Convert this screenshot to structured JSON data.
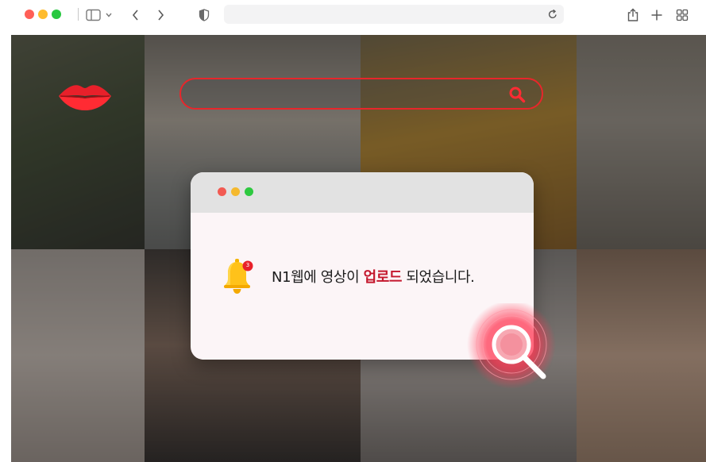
{
  "browser": {
    "url": "",
    "icons": {
      "sidebar": "sidebar-icon",
      "back": "chevron-left-icon",
      "forward": "chevron-right-icon",
      "privacy": "shield-icon",
      "reload": "reload-icon",
      "share": "share-icon",
      "new_tab": "plus-icon",
      "tabs": "tab-overview-icon"
    }
  },
  "page": {
    "logo": "lips-logo",
    "search": {
      "value": "",
      "icon": "search-icon"
    },
    "notification": {
      "prefix": "N1웹에 영상이 ",
      "highlight": "업로드",
      "suffix": " 되었습니다.",
      "badge_count": "3"
    }
  },
  "colors": {
    "accent_red": "#e8262b",
    "highlight_text": "#c4172d",
    "bell_yellow": "#ffc21a"
  }
}
